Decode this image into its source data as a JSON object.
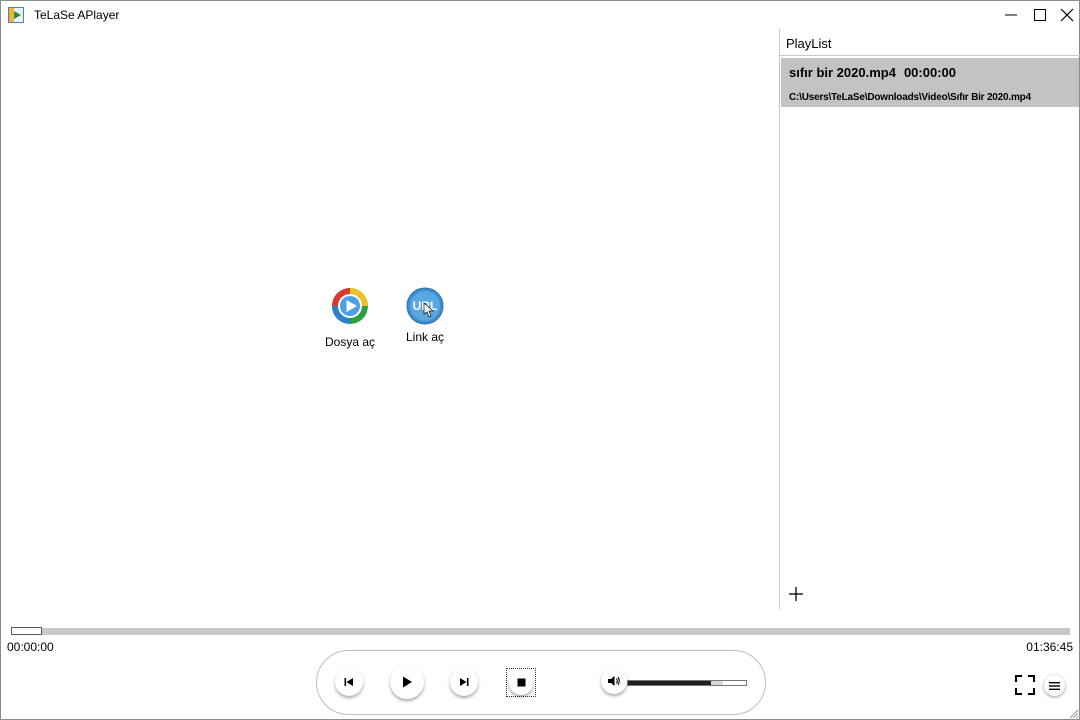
{
  "window": {
    "title": "TeLaSe APlayer"
  },
  "launcher": {
    "open_file_label": "Dosya aç",
    "open_link_label": "Link aç",
    "open_link_icon_text": "URL"
  },
  "playlist": {
    "header": "PlayList",
    "items": [
      {
        "name": "sıfır bir 2020.mp4",
        "duration": "00:00:00",
        "path": "C:\\Users\\TeLaSe\\Downloads\\Video\\Sıfır Bir 2020.mp4",
        "selected": true
      }
    ]
  },
  "seek": {
    "current_time": "00:00:00",
    "total_time": "01:36:45",
    "position": 0.0
  },
  "volume": {
    "level": 0.72
  },
  "icons": {
    "app": "app-icon",
    "minimize": "minimize-icon",
    "maximize": "maximize-icon",
    "close": "close-icon",
    "open_file": "play-disc-icon",
    "open_link": "url-hand-icon",
    "add": "plus-icon",
    "prev": "skip-previous-icon",
    "play": "play-icon",
    "next": "skip-next-icon",
    "stop": "stop-icon",
    "volume": "volume-icon",
    "fullscreen": "fullscreen-icon",
    "menu": "menu-icon"
  },
  "colors": {
    "selected_row": "#c3c3c3",
    "seek_track": "#c8c8c8",
    "volume_fill": "#1e1e1e",
    "link_icon_blue": "#3b8fd0"
  }
}
